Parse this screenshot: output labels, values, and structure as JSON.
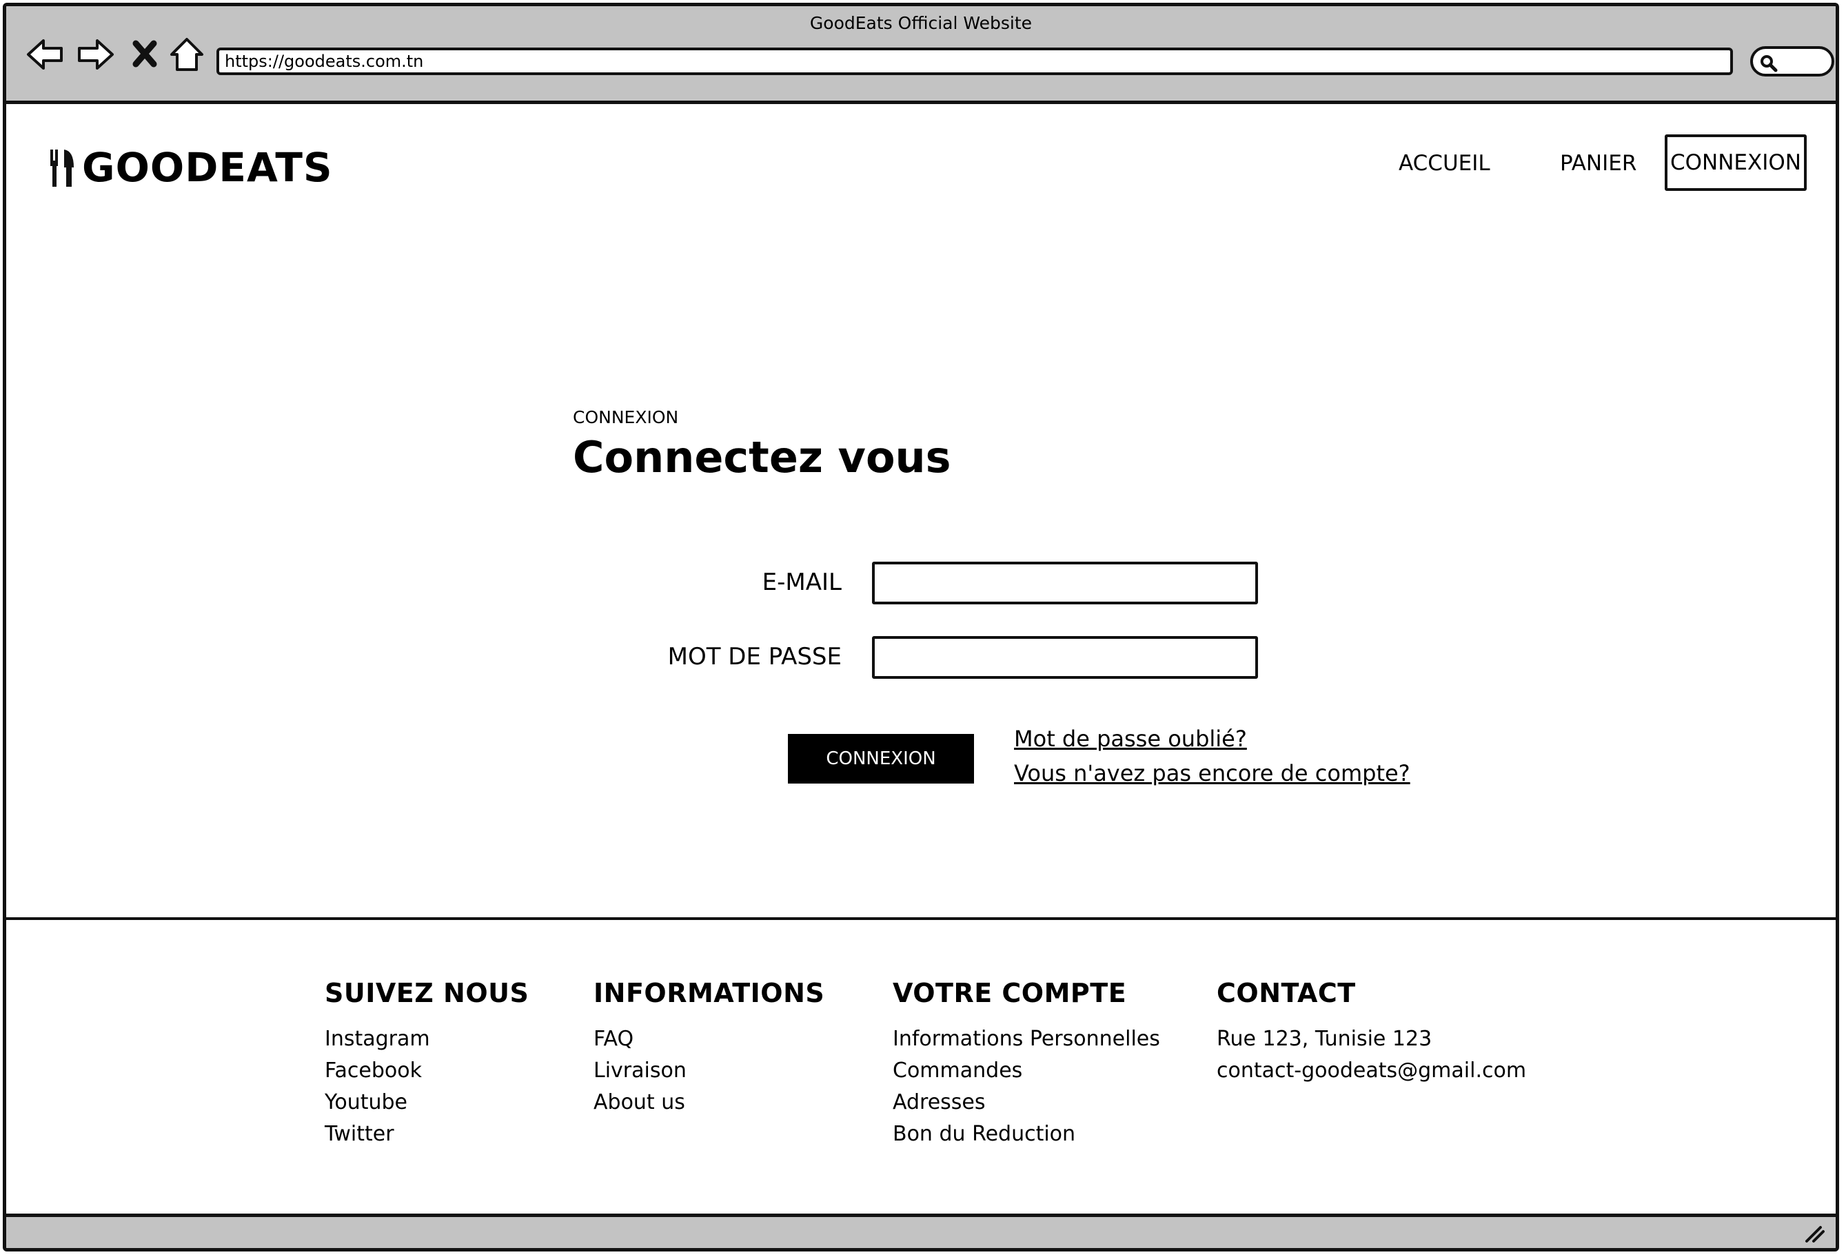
{
  "browser": {
    "window_title": "GoodEats Official Website",
    "url": "https://goodeats.com.tn"
  },
  "header": {
    "logo_text": "GOODEATS",
    "nav": {
      "home": "ACCUEIL",
      "cart": "PANIER",
      "login": "CONNEXION"
    }
  },
  "login": {
    "eyebrow": "CONNEXION",
    "title": "Connectez vous",
    "email_label": "E-MAIL",
    "email_value": "",
    "password_label": "MOT DE PASSE",
    "password_value": "",
    "submit_label": "CONNEXION",
    "forgot_link": "Mot de passe oublié?",
    "signup_link": "Vous n'avez pas encore de compte?"
  },
  "footer": {
    "follow": {
      "title": "SUIVEZ NOUS",
      "items": [
        "Instagram",
        "Facebook",
        "Youtube",
        "Twitter"
      ]
    },
    "info": {
      "title": "INFORMATIONS",
      "items": [
        "FAQ",
        "Livraison",
        "About us"
      ]
    },
    "account": {
      "title": "VOTRE COMPTE",
      "items": [
        "Informations Personnelles",
        "Commandes",
        "Adresses",
        "Bon du Reduction"
      ]
    },
    "contact": {
      "title": "CONTACT",
      "address": "Rue 123, Tunisie 123",
      "email": "contact-goodeats@gmail.com"
    }
  },
  "icons": {
    "back": "arrow-left-icon",
    "forward": "arrow-right-icon",
    "stop": "close-icon",
    "home": "home-icon",
    "search": "search-icon",
    "logo": "fork-knife-icon",
    "resize": "resize-grip-icon"
  },
  "colors": {
    "chrome": "#c3c3c3",
    "button": "#000000",
    "button_text": "#ffffff"
  }
}
